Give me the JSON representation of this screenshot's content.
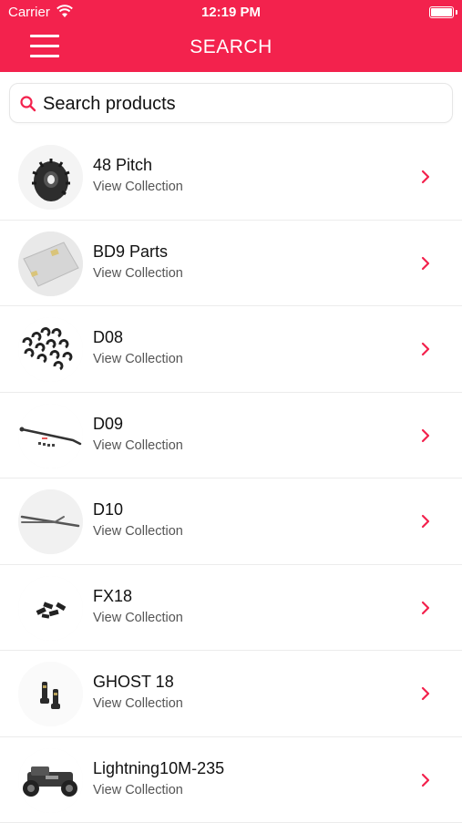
{
  "status": {
    "carrier": "Carrier",
    "time": "12:19 PM"
  },
  "header": {
    "title": "SEARCH",
    "accent_color": "#f3224d"
  },
  "search": {
    "placeholder": "Search products"
  },
  "collections": [
    {
      "name": "48 Pitch",
      "subtitle": "View Collection",
      "icon": "gear-thumbnail"
    },
    {
      "name": "BD9 Parts",
      "subtitle": "View Collection",
      "icon": "plate-thumbnail"
    },
    {
      "name": "D08",
      "subtitle": "View Collection",
      "icon": "e-clips-thumbnail"
    },
    {
      "name": "D09",
      "subtitle": "View Collection",
      "icon": "rod-thumbnail"
    },
    {
      "name": "D10",
      "subtitle": "View Collection",
      "icon": "tool-thumbnail"
    },
    {
      "name": "FX18",
      "subtitle": "View Collection",
      "icon": "screws-thumbnail"
    },
    {
      "name": "GHOST 18",
      "subtitle": "View Collection",
      "icon": "posts-thumbnail"
    },
    {
      "name": "Lightning10M-235",
      "subtitle": "View Collection",
      "icon": "car-thumbnail"
    }
  ]
}
